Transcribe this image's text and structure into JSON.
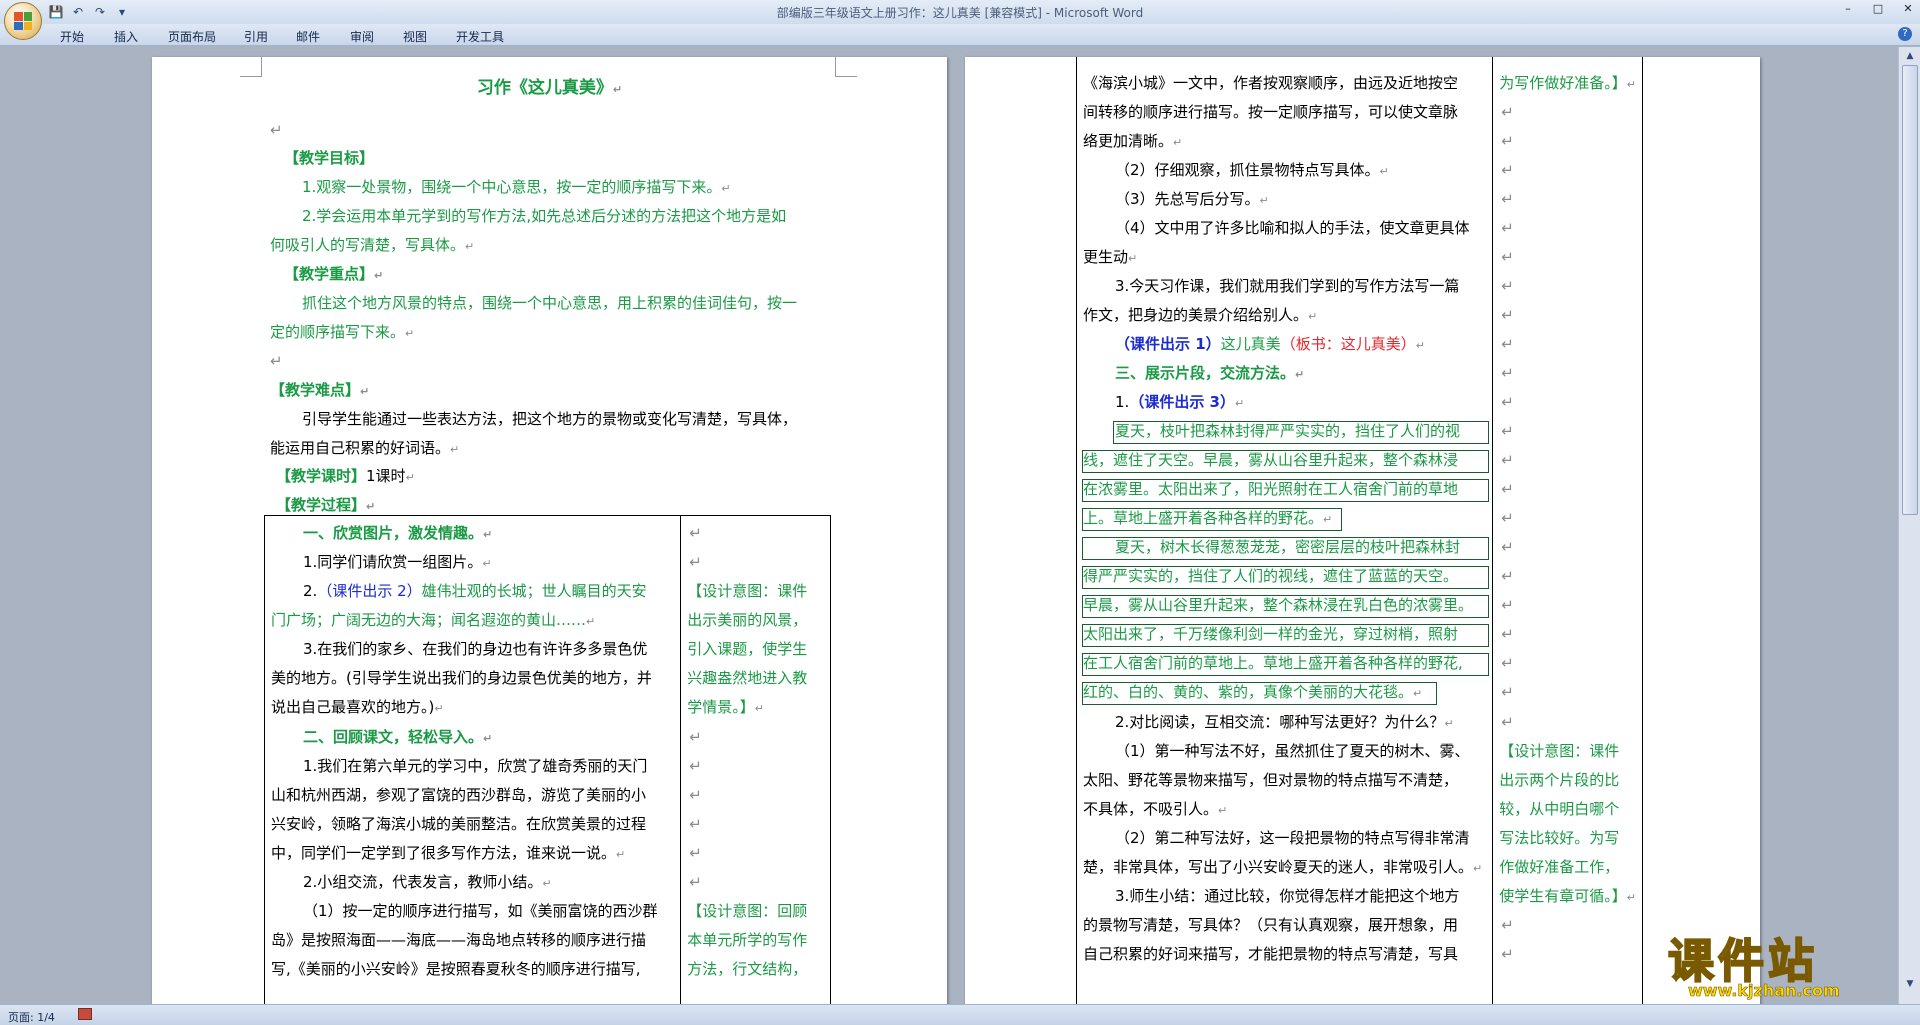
{
  "window": {
    "title": "部编版三年级语文上册习作：这儿真美 [兼容模式] - Microsoft Word",
    "controls": [
      "–",
      "□",
      "✕"
    ]
  },
  "ribbon": {
    "tabs": [
      "开始",
      "插入",
      "页面布局",
      "引用",
      "邮件",
      "审阅",
      "视图",
      "开发工具"
    ],
    "help": "?"
  },
  "qat": {
    "save_icon": "💾",
    "undo_icon": "↶",
    "redo_icon": "↷",
    "more_icon": "▾"
  },
  "status": {
    "page": "页面: 1/4"
  },
  "para_mark": "↵",
  "page1": {
    "title": "习作《这儿真美》",
    "goals_h": "【教学目标】",
    "goal1": "1.观察一处景物，围绕一个中心意思，按一定的顺序描写下来。",
    "goal2a": "2.学会运用本单元学到的写作方法,如先总述后分述的方法把这个地方是如",
    "goal2b": "何吸引人的写清楚，写具体。",
    "key_h": "【教学重点】",
    "key_a": "抓住这个地方风景的特点，围绕一个中心意思，用上积累的佳词佳句，按一",
    "key_b": "定的顺序描写下来。",
    "diff_h": "【教学难点】",
    "diff_a": "引导学生能通过一些表达方法，把这个地方的景物或变化写清楚，写具体，",
    "diff_b": "能运用自己积累的好词语。",
    "time_h": "【教学课时】",
    "time_v": "1课时",
    "proc_h": "【教学过程】",
    "t_s1": "一、欣赏图片，激发情趣。",
    "t_1": "1.同学们请欣赏一组图片。",
    "t_2pre": "2.",
    "t_2blue": "（课件出示 2）",
    "t_2a": "雄伟壮观的长城；世人瞩目的天安",
    "t_2b": "门广场；广阔无边的大海；闻名遐迩的黄山……",
    "t_3a": "3.在我们的家乡、在我们的身边也有许许多多景色优",
    "t_3b": "美的地方。(引导学生说出我们的身边景色优美的地方，并",
    "t_3c": "说出自己最喜欢的地方。)",
    "t_s2": "二、回顾课文，轻松导入。",
    "t_4a": "1.我们在第六单元的学习中，欣赏了雄奇秀丽的天门",
    "t_4b": "山和杭州西湖，参观了富饶的西沙群岛，游览了美丽的小",
    "t_4c": "兴安岭，领略了海滨小城的美丽整洁。在欣赏美景的过程",
    "t_4d": "中，同学们一定学到了很多写作方法，谁来说一说。",
    "t_5": "2.小组交流，代表发言，教师小结。",
    "t_6a": "（1）按一定的顺序进行描写，如《美丽富饶的西沙群",
    "t_6b": "岛》是按照海面——海底——海岛地点转移的顺序进行描",
    "t_6c": "写,《美丽的小兴安岭》是按照春夏秋冬的顺序进行描写,",
    "r1": [
      "【设计意图：课件",
      "出示美丽的风景，",
      "引入课题，使学生",
      "兴趣盎然地进入教",
      "学情景。】"
    ],
    "r2": [
      "【设计意图：回顾",
      "本单元所学的写作",
      "方法，行文结构，"
    ]
  },
  "page2": {
    "l1a": "《海滨小城》一文中，作者按观察顺序，由远及近地按空",
    "l1b": "间转移的顺序进行描写。按一定顺序描写，可以使文章脉",
    "l1c": "络更加清晰。",
    "l2": "（2）仔细观察，抓住景物特点写具体。",
    "l3": "（3）先总写后分写。",
    "l4a": "（4）文中用了许多比喻和拟人的手法，使文章更具体",
    "l4b": "更生动",
    "l5a": "3.今天习作课，我们就用我们学到的写作方法写一篇",
    "l5b": "作文，把身边的美景介绍给别人。",
    "l6blue": "（课件出示 1）",
    "l6green": "这儿真美",
    "l6red": "（板书：这儿真美）",
    "s3": "三、展示片段，交流方法。",
    "l7pre": "1.",
    "l7blue": "（课件出示 3）",
    "frag1": [
      "夏天，枝叶把森林封得严严实实的，挡住了人们的视",
      "线，遮住了天空。早晨，雾从山谷里升起来，整个森林浸",
      "在浓雾里。太阳出来了，阳光照射在工人宿舍门前的草地",
      "上。草地上盛开着各种各样的野花。"
    ],
    "frag2": [
      "夏天，树木长得葱葱茏茏，密密层层的枝叶把森林封",
      "得严严实实的，挡住了人们的视线，遮住了蓝蓝的天空。",
      "早晨，雾从山谷里升起来，整个森林浸在乳白色的浓雾里。",
      "太阳出来了，千万缕像利剑一样的金光，穿过树梢，照射",
      "在工人宿舍门前的草地上。草地上盛开着各种各样的野花,",
      "红的、白的、黄的、紫的，真像个美丽的大花毯。"
    ],
    "l8": "2.对比阅读，互相交流：哪种写法更好？为什么？",
    "l9a": "（1）第一种写法不好，虽然抓住了夏天的树木、雾、",
    "l9b": "太阳、野花等景物来描写，但对景物的特点描写不清楚，",
    "l9c": "不具体，不吸引人。",
    "l10a": "（2）第二种写法好，这一段把景物的特点写得非常清",
    "l10b": "楚，非常具体，写出了小兴安岭夏天的迷人，非常吸引人。",
    "l11a": "3.师生小结：通过比较，你觉得怎样才能把这个地方",
    "l11b": "的景物写清楚，写具体？（只有认真观察，展开想象，用",
    "l11c": "自己积累的好词来描写，才能把景物的特点写清楚，写具",
    "r_top": "为写作做好准备。】",
    "r_mid": [
      "【设计意图：课件",
      "出示两个片段的比",
      "较，从中明白哪个",
      "写法比较好。为写",
      "作做好准备工作，",
      "使学生有章可循。】"
    ]
  },
  "watermark": {
    "big": "课件站",
    "url": "www.kjzhan.com"
  },
  "colors": {
    "green": "#1b9a46",
    "blue": "#1a2ccf",
    "red": "#e5262b"
  }
}
